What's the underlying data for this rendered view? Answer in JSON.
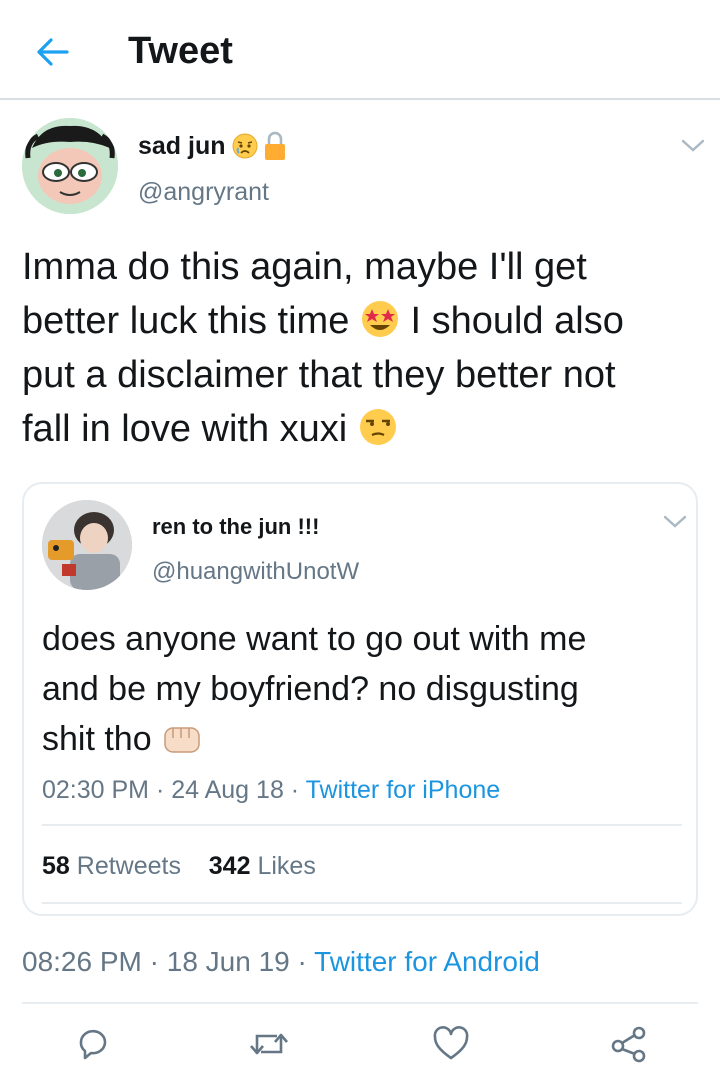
{
  "header": {
    "title": "Tweet",
    "back_icon": "arrow-left-icon"
  },
  "tweet": {
    "author": {
      "display_name": "sad jun",
      "handle": "@angryrant",
      "badges": [
        "weary-face-emoji",
        "lock-icon"
      ]
    },
    "text_lines": [
      "Imma do this again, maybe I'll get",
      "better luck this time",
      "I should also",
      "put a disclaimer that they better not",
      "fall in love with xuxi"
    ],
    "emojis": [
      "star-struck-emoji",
      "unamused-face-emoji"
    ],
    "meta": {
      "time": "08:26 PM",
      "sep1": " · ",
      "date": "18 Jun 19",
      "sep2": " · ",
      "source": "Twitter for Android"
    }
  },
  "quoted_tweet": {
    "author": {
      "display_name": "ren to the jun !!!",
      "handle": "@huangwithUnotW"
    },
    "text_lines": [
      "does anyone want to go out with me",
      "and be my boyfriend? no disgusting",
      "shit tho"
    ],
    "emojis": [
      "oncoming-fist-emoji"
    ],
    "meta": {
      "time": "02:30 PM",
      "sep1": " · ",
      "date": "24 Aug 18",
      "sep2": " · ",
      "source": "Twitter for iPhone"
    },
    "stats": {
      "retweets_count": "58",
      "retweets_label": "Retweets",
      "likes_count": "342",
      "likes_label": "Likes"
    }
  },
  "actions": [
    "reply-icon",
    "retweet-icon",
    "like-icon",
    "share-icon"
  ],
  "colors": {
    "link": "#1b95e0",
    "muted": "#657786",
    "text": "#14171a",
    "divider": "#e6ecf0",
    "accent": "#1da1f2"
  }
}
